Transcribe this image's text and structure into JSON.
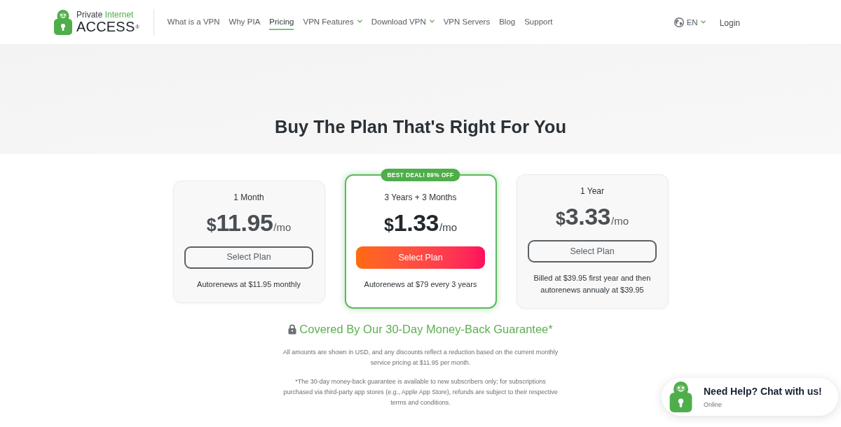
{
  "header": {
    "logo": {
      "line_1": "Private",
      "line_1_accent": "Internet",
      "line_2": "ACCESS",
      "mark": "®"
    },
    "nav": [
      {
        "label": "What is a VPN",
        "selected": false,
        "dropdown": false
      },
      {
        "label": "Why PIA",
        "selected": false,
        "dropdown": false
      },
      {
        "label": "Pricing",
        "selected": true,
        "dropdown": false
      },
      {
        "label": "VPN Features",
        "selected": false,
        "dropdown": true
      },
      {
        "label": "Download VPN",
        "selected": false,
        "dropdown": true
      },
      {
        "label": "VPN Servers",
        "selected": false,
        "dropdown": false
      },
      {
        "label": "Blog",
        "selected": false,
        "dropdown": false
      },
      {
        "label": "Support",
        "selected": false,
        "dropdown": false
      }
    ],
    "language": "EN",
    "login": "Login"
  },
  "hero": {
    "title": "Buy The Plan That's Right For You"
  },
  "plans": [
    {
      "term": "1 Month",
      "currency": "$",
      "amount": "11.95",
      "unit": "/mo",
      "button": "Select Plan",
      "note": "Autorenews at $11.95 monthly",
      "featured": false
    },
    {
      "term": "3 Years + 3 Months",
      "currency": "$",
      "amount": "1.33",
      "unit": "/mo",
      "button": "Select Plan",
      "note": "Autorenews at $79 every 3 years",
      "featured": true,
      "badge": "BEST DEAL! 89% OFF"
    },
    {
      "term": "1 Year",
      "currency": "$",
      "amount": "3.33",
      "unit": "/mo",
      "button": "Select Plan",
      "note": "Billed at $39.95 first year and then autorenews annualy at $39.95",
      "featured": false
    }
  ],
  "guarantee": {
    "title": "Covered By Our 30-Day Money-Back Guarantee*"
  },
  "disclaimers": [
    "All amounts are shown in USD, and any discounts reflect a reduction based on the current monthly service pricing at $11.95 per month.",
    "*The 30-day money-back guarantee is available to new subscribers only; for subscriptions purchased via third-party app stores (e.g., Apple App Store), refunds are subject to their respective terms and conditions."
  ],
  "chat": {
    "title": "Need Help? Chat with us!",
    "status": "Online"
  }
}
